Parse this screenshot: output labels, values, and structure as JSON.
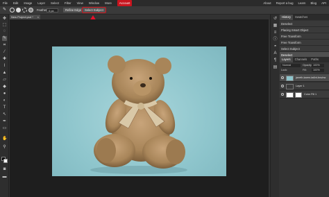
{
  "menu": {
    "items": [
      "File",
      "Edit",
      "Image",
      "Layer",
      "Select",
      "Filter",
      "View",
      "Window",
      "More"
    ],
    "account": "Account",
    "right": [
      "About",
      "Report a bug",
      "Learn",
      "Blog",
      "API"
    ]
  },
  "options": {
    "feather_label": "Feather:",
    "feather_value": "0 px",
    "refine_edge": "Refine Edge",
    "select_subject": "Select Subject"
  },
  "document": {
    "tab_title": "New Project.psd *",
    "close": "×"
  },
  "history_panel": {
    "tabs": [
      "History",
      "Swatches"
    ],
    "items": [
      "Deselect",
      "Placing Smart Object",
      "Free Transform",
      "Free Transform",
      "Select Subject",
      "Deselect"
    ]
  },
  "layers_panel": {
    "tabs": [
      "Layers",
      "Channels",
      "Paths"
    ],
    "blend_mode": "Normal",
    "opacity_label": "Opacity:",
    "opacity_value": "100%",
    "lock_label": "Lock:",
    "fill_label": "Fill:",
    "fill_value": "100%",
    "layers": [
      "janeth-karen-ta6nt-bnuhw",
      "Layer 1",
      "Color Fill 1"
    ]
  },
  "colors": {
    "accent": "#c8141e",
    "background": "#323232",
    "canvas_bg": "#1e1e1e",
    "photo_bg": "#8ec5cc"
  }
}
